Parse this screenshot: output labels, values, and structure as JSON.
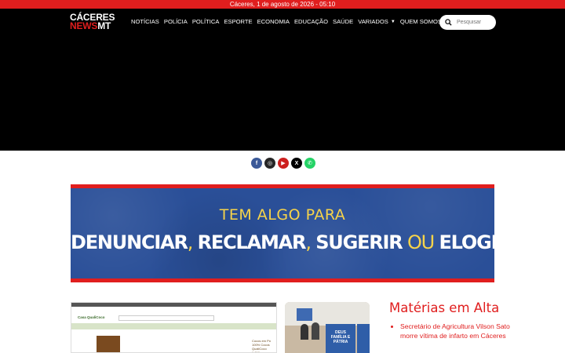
{
  "topbar": {
    "date_time": "Cáceres, 1 de agosto de 2026 - 05:10"
  },
  "logo": {
    "line1": "CÁCERES",
    "line2_a": "NEWS",
    "line2_b": "MT"
  },
  "nav": {
    "items": [
      {
        "label": "NOTÍCIAS",
        "dropdown": false
      },
      {
        "label": "POLÍCIA",
        "dropdown": false
      },
      {
        "label": "POLÍTICA",
        "dropdown": false
      },
      {
        "label": "ESPORTE",
        "dropdown": false
      },
      {
        "label": "ECONOMIA",
        "dropdown": false
      },
      {
        "label": "EDUCAÇÃO",
        "dropdown": false
      },
      {
        "label": "SAÚDE",
        "dropdown": false
      },
      {
        "label": "VARIADOS",
        "dropdown": true
      },
      {
        "label": "QUEM SOMOS",
        "dropdown": true
      }
    ]
  },
  "search": {
    "placeholder": "Pesquisar",
    "icon": "search-icon"
  },
  "social": [
    {
      "name": "facebook-icon",
      "glyph": "f",
      "color": "#3b5998"
    },
    {
      "name": "instagram-icon",
      "glyph": "◎",
      "color": "#262626"
    },
    {
      "name": "youtube-icon",
      "glyph": "▶",
      "color": "#cd201f"
    },
    {
      "name": "x-twitter-icon",
      "glyph": "X",
      "color": "#000000"
    },
    {
      "name": "whatsapp-icon",
      "glyph": "✆",
      "color": "#25d366"
    }
  ],
  "banner": {
    "line1": "TEM ALGO PARA",
    "word1": "DENUNCIAR",
    "sep1": ", ",
    "word2": "RECLAMAR",
    "sep2": ", ",
    "word3": "SUGERIR",
    "sep3": " OU ",
    "word4": "ELOGIAR?"
  },
  "articles": {
    "thumb1_logo": "Casa QualiCoco",
    "thumb1_product_title": "Cocos em Pó 100% Cocos QualiCoco 1,010g",
    "thumb2_sign": "DEUS FAMÍLIA E PÁTRIA"
  },
  "sidebar": {
    "title": "Matérias em Alta",
    "items": [
      "Secretário de Agricultura Vilson Sato morre vítima de infarto em Cáceres"
    ]
  },
  "colors": {
    "brand_red": "#e01e1e",
    "banner_blue": "#2a4f98",
    "accent_yellow": "#f7d44a"
  }
}
